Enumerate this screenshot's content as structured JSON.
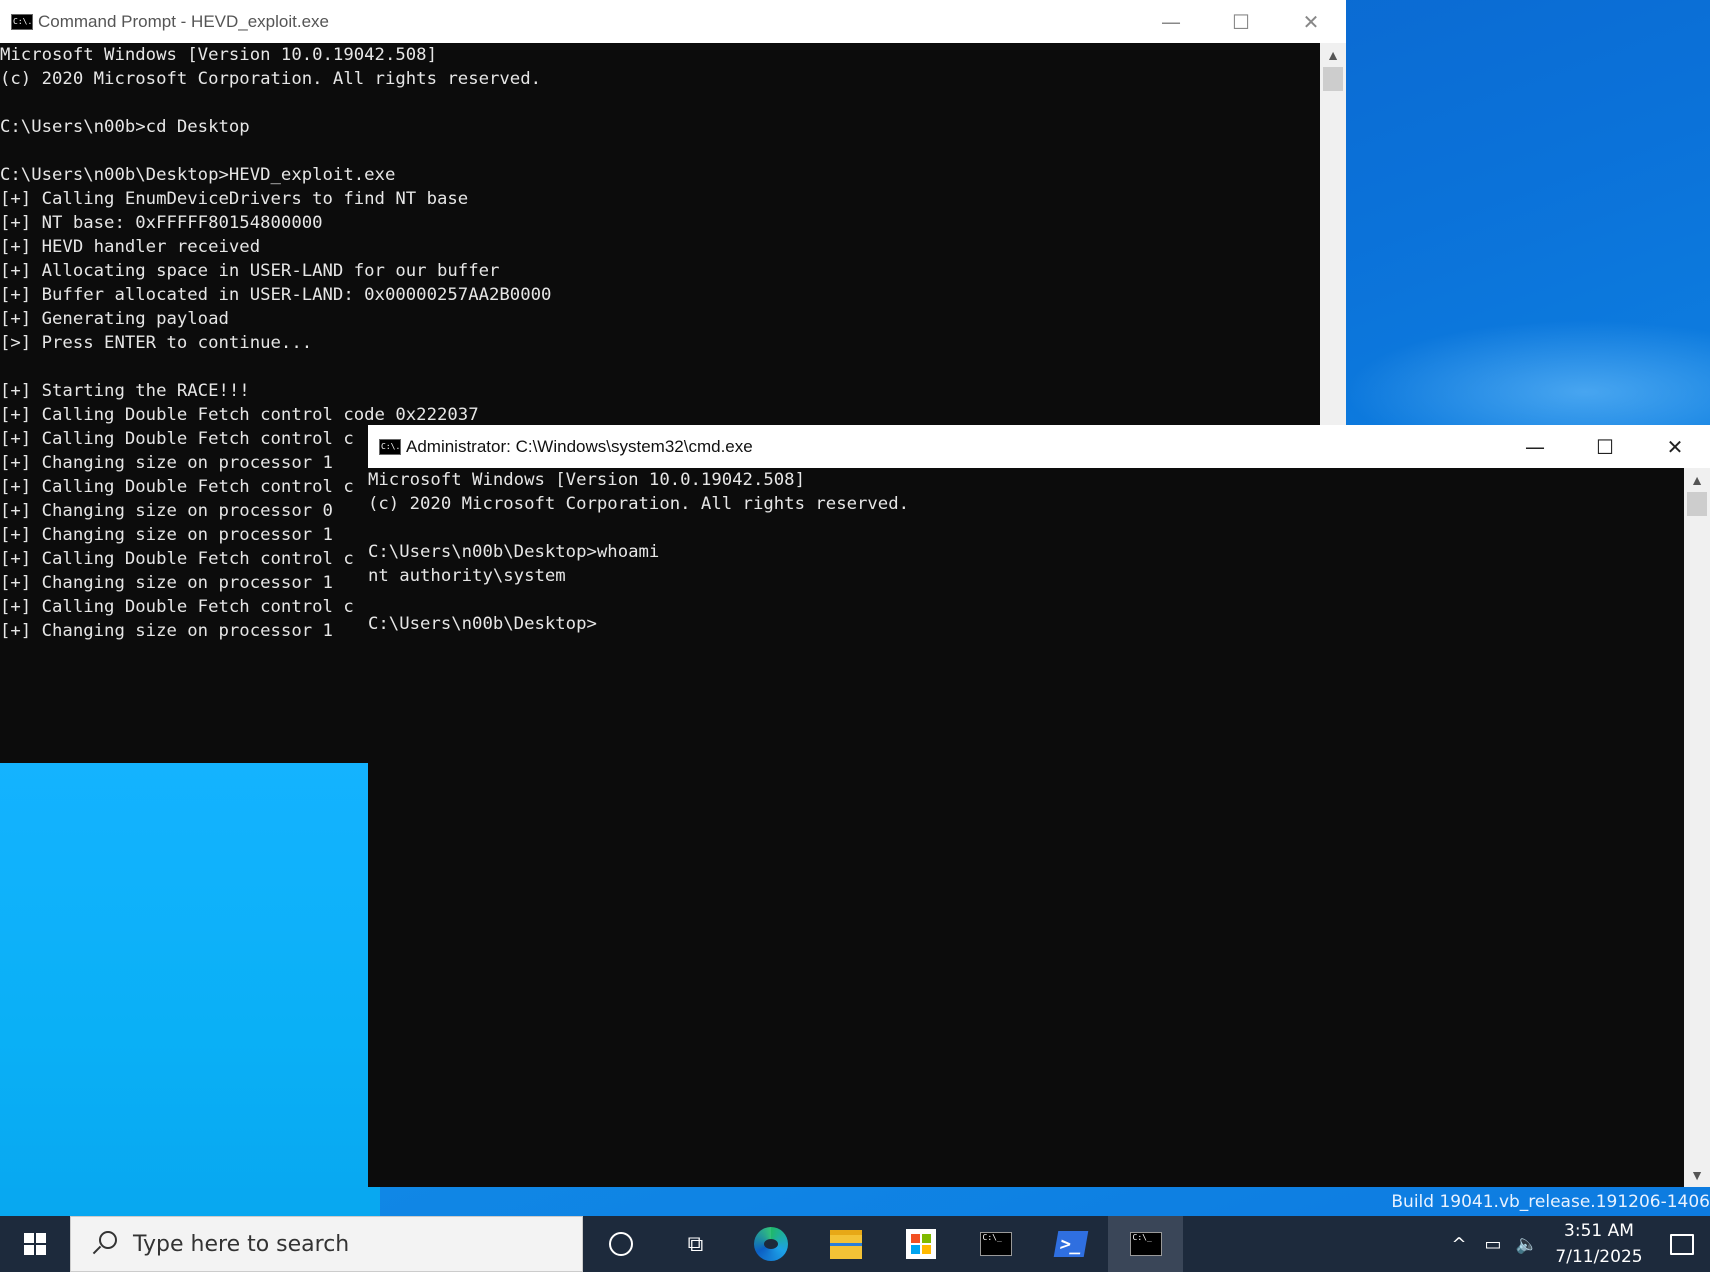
{
  "desktop": {
    "build_text": "Build 19041.vb_release.191206-1406"
  },
  "window1": {
    "title": "Command Prompt - HEVD_exploit.exe",
    "icon_text": "C:\\.",
    "minimize": "—",
    "maximize": "☐",
    "close": "✕",
    "lines": [
      "Microsoft Windows [Version 10.0.19042.508]",
      "(c) 2020 Microsoft Corporation. All rights reserved.",
      "",
      "C:\\Users\\n00b>cd Desktop",
      "",
      "C:\\Users\\n00b\\Desktop>HEVD_exploit.exe",
      "[+] Calling EnumDeviceDrivers to find NT base",
      "[+] NT base: 0xFFFFF80154800000",
      "[+] HEVD handler received",
      "[+] Allocating space in USER-LAND for our buffer",
      "[+] Buffer allocated in USER-LAND: 0x00000257AA2B0000",
      "[+] Generating payload",
      "[>] Press ENTER to continue...",
      "",
      "[+] Starting the RACE!!!",
      "[+] Calling Double Fetch control code 0x222037",
      "[+] Calling Double Fetch control c",
      "[+] Changing size on processor 1",
      "[+] Calling Double Fetch control c",
      "[+] Changing size on processor 0",
      "[+] Changing size on processor 1",
      "[+] Calling Double Fetch control c",
      "[+] Changing size on processor 1",
      "[+] Calling Double Fetch control c",
      "[+] Changing size on processor 1"
    ]
  },
  "window2": {
    "title": "Administrator: C:\\Windows\\system32\\cmd.exe",
    "icon_text": "C:\\.",
    "minimize": "—",
    "maximize": "☐",
    "close": "✕",
    "lines": [
      "Microsoft Windows [Version 10.0.19042.508]",
      "(c) 2020 Microsoft Corporation. All rights reserved.",
      "",
      "C:\\Users\\n00b\\Desktop>whoami",
      "nt authority\\system",
      "",
      "C:\\Users\\n00b\\Desktop>"
    ]
  },
  "taskbar": {
    "search_placeholder": "Type here to search",
    "clock_time": "3:51 AM",
    "clock_date": "7/11/2025",
    "cmd_icon_text": "C:\\_",
    "ps_icon_text": ">_",
    "tray_chevron": "^",
    "network_glyph": "▭",
    "volume_glyph": "🔈"
  }
}
